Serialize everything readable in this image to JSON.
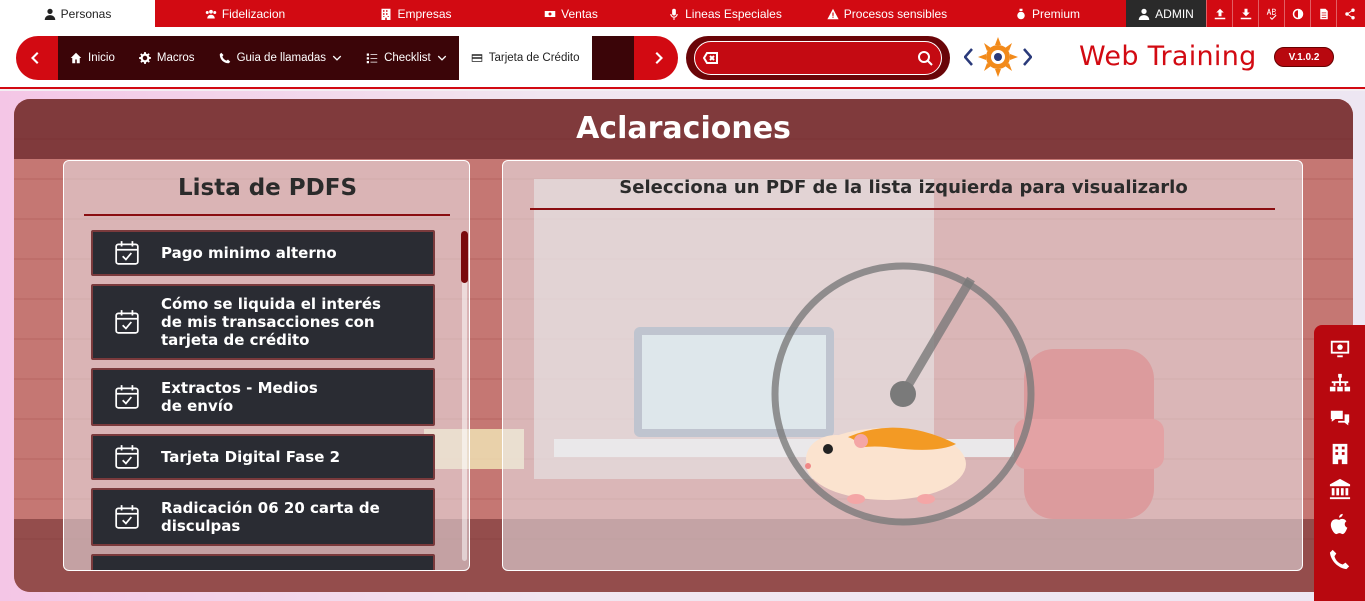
{
  "top_tabs": [
    {
      "label": "Personas",
      "icon": "person-icon",
      "active": true
    },
    {
      "label": "Fidelizacion",
      "icon": "users-icon"
    },
    {
      "label": "Empresas",
      "icon": "building-icon"
    },
    {
      "label": "Ventas",
      "icon": "money-icon"
    },
    {
      "label": "Lineas Especiales",
      "icon": "microphone-icon"
    },
    {
      "label": "Procesos sensibles",
      "icon": "warning-icon"
    },
    {
      "label": "Premium",
      "icon": "award-icon"
    }
  ],
  "user": {
    "label": "ADMIN",
    "icon": "user-icon"
  },
  "tools": [
    "upload-icon",
    "download-icon",
    "spellcheck-icon",
    "contrast-icon",
    "document-icon",
    "share-icon"
  ],
  "nav": {
    "items": [
      {
        "label": "Inicio",
        "icon": "home-icon"
      },
      {
        "label": "Macros",
        "icon": "gear-icon"
      },
      {
        "label": "Guia de llamadas",
        "icon": "phone-icon",
        "dropdown": true
      },
      {
        "label": "Checklist",
        "icon": "checklist-icon",
        "dropdown": true
      },
      {
        "label": "Tarjeta de Crédito",
        "icon": "credit-card-icon",
        "active": true
      }
    ]
  },
  "search": {
    "placeholder": "",
    "value": ""
  },
  "brand": {
    "name": "Web Training",
    "version": "V.1.0.2"
  },
  "main": {
    "title": "Aclaraciones",
    "list_title": "Lista de PDFS",
    "pdfs": [
      "Pago minimo alterno",
      "Cómo se liquida el interés\nde mis transacciones con\ntarjeta de crédito",
      "Extractos - Medios\nde envío",
      "Tarjeta Digital Fase 2",
      "Radicación 06 20 carta de\ndisculpas"
    ],
    "viewer_message": "Selecciona un PDF de la lista izquierda para visualizarlo"
  },
  "sidebar_icons": [
    "monitor-settings-icon",
    "org-chart-icon",
    "chat-icon",
    "building-icon",
    "bank-icon",
    "apple-icon",
    "phone-hand-icon"
  ],
  "colors": {
    "brand_red": "#d20a12",
    "dark_red": "#3b0508",
    "item_bg": "#2a2c33"
  }
}
